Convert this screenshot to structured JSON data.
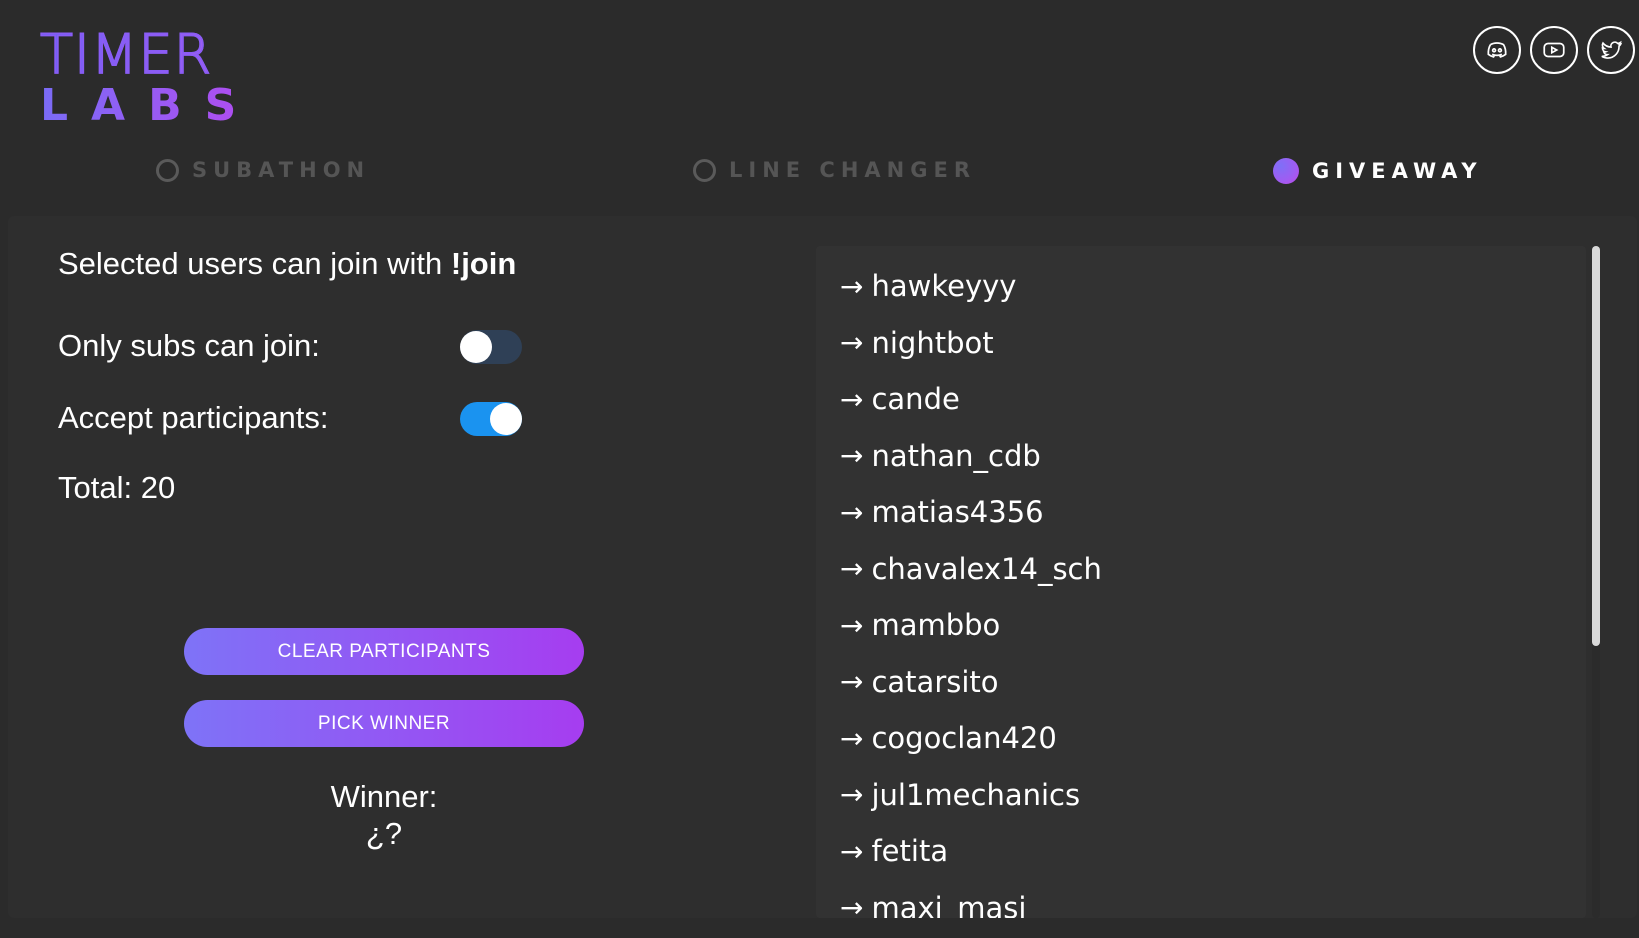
{
  "logo": {
    "top": "TIMER",
    "bottom": "LABS"
  },
  "socials": [
    {
      "icon": "discord-icon",
      "label": "discord"
    },
    {
      "icon": "youtube-icon",
      "label": "youtube"
    },
    {
      "icon": "twitter-icon",
      "label": "twitter"
    }
  ],
  "tabs": [
    {
      "label": "SUBATHON",
      "active": false
    },
    {
      "label": "LINE CHANGER",
      "active": false
    },
    {
      "label": "GIVEAWAY",
      "active": true
    }
  ],
  "giveaway": {
    "join_prefix": "Selected users can join with ",
    "join_command": "!join",
    "subs_only_label": "Only subs can join:",
    "subs_only_enabled": false,
    "accept_label": "Accept participants:",
    "accept_enabled": true,
    "total_label": "Total: 20",
    "clear_button": "CLEAR PARTICIPANTS",
    "pick_button": "PICK WINNER",
    "winner_label": "Winner:",
    "winner_value": "¿?"
  },
  "participants": [
    "hawkeyyy",
    "nightbot",
    "cande",
    "nathan_cdb",
    "matias4356",
    "chavalex14_sch",
    "mambbo",
    "catarsito",
    "cogoclan420",
    "jul1mechanics",
    "fetita",
    "maxi_masi"
  ],
  "arrow": "→",
  "colors": {
    "background": "#2b2b2b",
    "accent_start": "#7e73f7",
    "accent_end": "#a63df0",
    "toggle_on": "#1a93f0",
    "toggle_off": "#2f4056"
  }
}
